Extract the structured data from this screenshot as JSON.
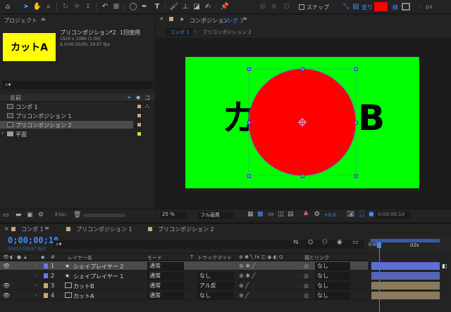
{
  "toolbar": {
    "snap_label": "スナップ",
    "fill_label": "塗り",
    "stroke_label": "線",
    "stroke_width": "-",
    "px_label": "px",
    "fill_color": "#ff0000",
    "icons": [
      "home-icon",
      "selection-arrow-icon",
      "hand-icon",
      "zoom-icon",
      "orbit-icon",
      "move-icon",
      "track-icon",
      "rotate-icon",
      "pan-behind-icon",
      "ellipse-icon",
      "pen-icon",
      "text-icon",
      "brush-icon",
      "clone-stamp-icon",
      "eraser-icon",
      "roto-brush-icon",
      "puppet-pin-icon"
    ]
  },
  "project": {
    "title": "プロジェクト",
    "thumb_text": "カットA",
    "selected_name": "プリコンポジション 2",
    "usage": "1回使用",
    "resolution": "1920 x 1080 (1.00)",
    "duration": "Δ 0;00;30;00, 29.97 fps",
    "col_name": "名前",
    "bpc": "8 bpc",
    "items": [
      {
        "name": "コンポ 1",
        "color": "#c7a877"
      },
      {
        "name": "プリコンポジション 1",
        "color": "#c7a877"
      },
      {
        "name": "プリコンポジション 2",
        "color": "#c7a877"
      },
      {
        "name": "平面",
        "color": "#e6d23e"
      }
    ]
  },
  "comp_panel": {
    "title_prefix": "コンポジション",
    "title_active": "コンポ 1",
    "breadcrumb_active": "コンポ 1",
    "breadcrumb_next": "プリコンポジション 2",
    "canvas_left_text": "カ",
    "canvas_right_text": "B",
    "canvas_bg": "#00ff00",
    "circle_color": "#ff0000",
    "zoom": "25 %",
    "resolution": "フル画質",
    "exposure": "+0.0",
    "timecode": "0;00;00;10"
  },
  "timeline": {
    "tabs": [
      "コンポ 1",
      "プリコンポジション 1",
      "プリコンポジション 2"
    ],
    "timecode": "0;00;00;10",
    "timecode_sub": "00010 (29.97 fps)",
    "col_layer_name": "レイヤー名",
    "col_mode": "モード",
    "col_t": "T",
    "col_trackmatte": "トラックマット",
    "col_parent": "親とリンク",
    "ruler_start": "0:00s",
    "ruler_mark": "02s",
    "layers": [
      {
        "num": "1",
        "name": "シェイプレイヤー 2",
        "mode": "通常",
        "trackmatte": "",
        "parent": "なし",
        "color": "#6b78ff",
        "selected": true
      },
      {
        "num": "2",
        "name": "シェイプレイヤー 1",
        "mode": "通常",
        "trackmatte": "なし",
        "parent": "なし",
        "color": "#6b78ff",
        "selected": false
      },
      {
        "num": "3",
        "name": "カットB",
        "mode": "通常",
        "trackmatte": "アル反",
        "parent": "なし",
        "color": "#c7a877",
        "selected": false
      },
      {
        "num": "4",
        "name": "カットA",
        "mode": "通常",
        "trackmatte": "なし",
        "parent": "なし",
        "color": "#c7a877",
        "selected": false
      }
    ]
  }
}
